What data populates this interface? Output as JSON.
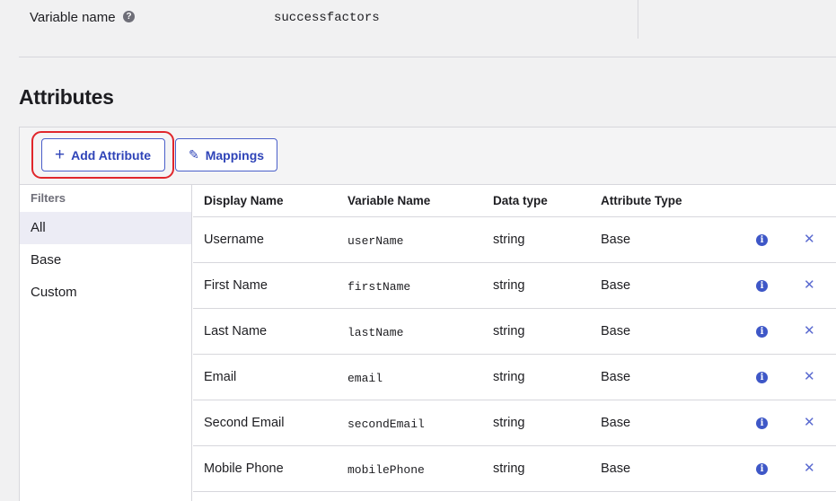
{
  "variable": {
    "label": "Variable name",
    "help_icon": "?",
    "value": "successfactors"
  },
  "section_title": "Attributes",
  "toolbar": {
    "add_icon": "+",
    "add_label": "Add Attribute",
    "mappings_icon": "✎",
    "mappings_label": "Mappings",
    "highlight_color": "#e0262b"
  },
  "filters": {
    "title": "Filters",
    "items": [
      "All",
      "Base",
      "Custom"
    ],
    "active": "All"
  },
  "table": {
    "columns": [
      "Display Name",
      "Variable Name",
      "Data type",
      "Attribute Type"
    ],
    "rows": [
      {
        "display": "Username",
        "variable": "userName",
        "type": "string",
        "attr": "Base"
      },
      {
        "display": "First Name",
        "variable": "firstName",
        "type": "string",
        "attr": "Base"
      },
      {
        "display": "Last Name",
        "variable": "lastName",
        "type": "string",
        "attr": "Base"
      },
      {
        "display": "Email",
        "variable": "email",
        "type": "string",
        "attr": "Base"
      },
      {
        "display": "Second Email",
        "variable": "secondEmail",
        "type": "string",
        "attr": "Base"
      },
      {
        "display": "Mobile Phone",
        "variable": "mobilePhone",
        "type": "string",
        "attr": "Base"
      }
    ],
    "info_icon": "i",
    "delete_icon": "✕"
  },
  "colors": {
    "accent": "#2f44b8",
    "info": "#3e57c7",
    "border": "#d7d7dc"
  }
}
